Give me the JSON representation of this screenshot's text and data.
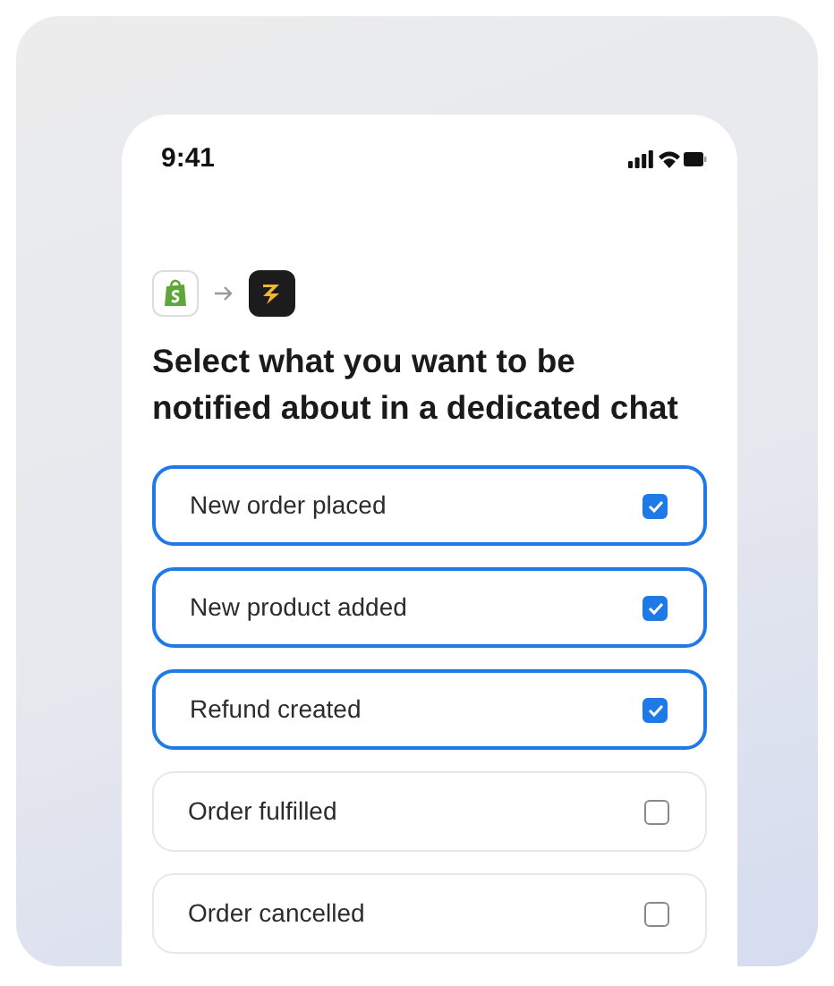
{
  "status_bar": {
    "time": "9:41"
  },
  "heading": "Select what you want to be notified about in a dedicated chat",
  "options": [
    {
      "label": "New order placed",
      "checked": true
    },
    {
      "label": "New product added",
      "checked": true
    },
    {
      "label": "Refund created",
      "checked": true
    },
    {
      "label": "Order fulfilled",
      "checked": false
    },
    {
      "label": "Order cancelled",
      "checked": false
    }
  ]
}
